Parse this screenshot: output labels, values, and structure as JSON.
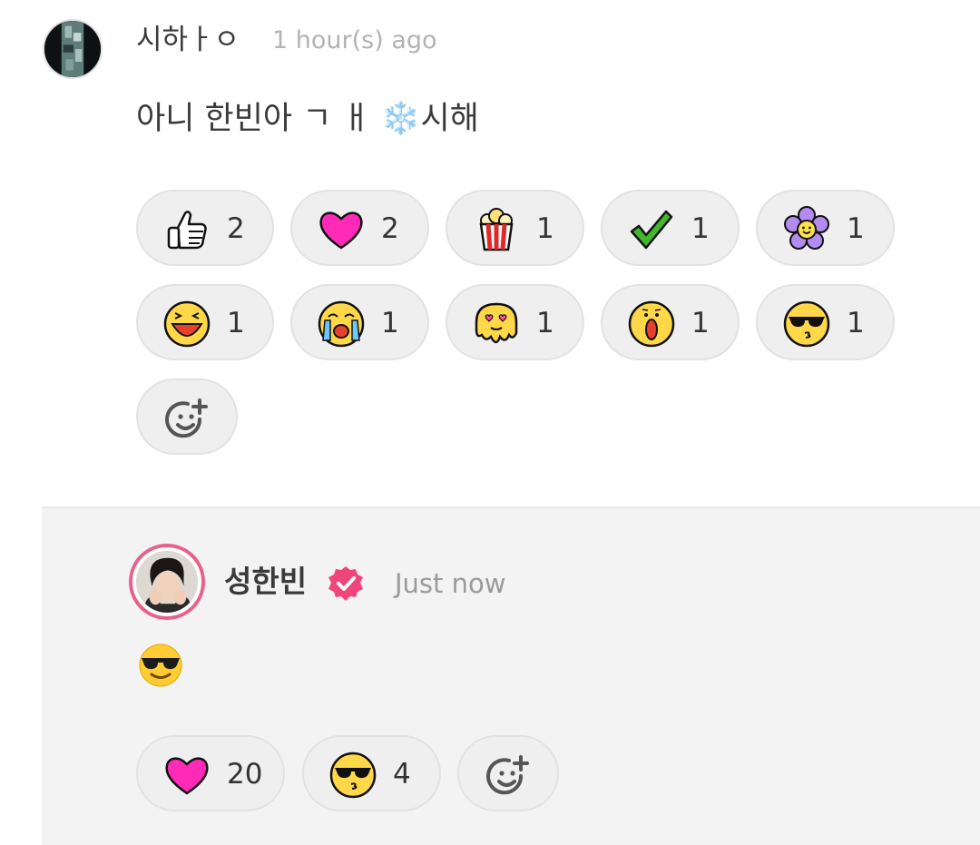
{
  "comment": {
    "username": "시하ㅏㅇ",
    "timestamp": "1 hour(s) ago",
    "text": "아니 한빈아 ㄱ ㅐ ❄️시해",
    "reactions": [
      {
        "icon": "thumbs-up-icon",
        "count": "2"
      },
      {
        "icon": "pink-heart-icon",
        "count": "2"
      },
      {
        "icon": "popcorn-icon",
        "count": "1"
      },
      {
        "icon": "green-check-icon",
        "count": "1"
      },
      {
        "icon": "purple-flower-icon",
        "count": "1"
      },
      {
        "icon": "laughing-face-icon",
        "count": "1"
      },
      {
        "icon": "crying-face-icon",
        "count": "1"
      },
      {
        "icon": "melting-heart-eyes-icon",
        "count": "1"
      },
      {
        "icon": "shocked-face-icon",
        "count": "1"
      },
      {
        "icon": "sunglasses-kiss-face-icon",
        "count": "1"
      }
    ],
    "add_reaction_icon": "add-reaction-icon"
  },
  "reply": {
    "username": "성한빈",
    "verified_icon": "verified-badge-icon",
    "timestamp": "Just now",
    "emoji_text": "😎",
    "reactions": [
      {
        "icon": "pink-heart-icon",
        "count": "20"
      },
      {
        "icon": "sunglasses-kiss-face-icon",
        "count": "4"
      }
    ],
    "add_reaction_icon": "add-reaction-icon"
  },
  "colors": {
    "accent_pink": "#e8618c",
    "verified_pink": "#f0457a",
    "pill_bg": "#efefef",
    "reply_bg": "#f3f3f3",
    "muted_text": "#b3b3b3"
  }
}
